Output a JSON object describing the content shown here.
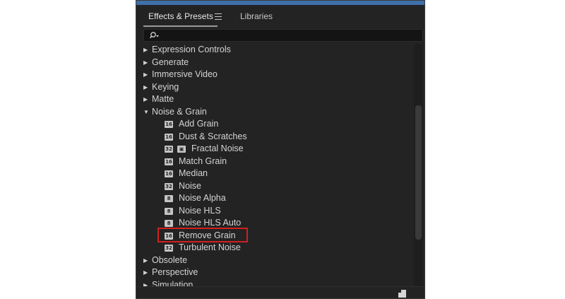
{
  "panel": {
    "tabs": [
      {
        "label": "Effects & Presets"
      },
      {
        "label": "Libraries"
      }
    ],
    "search": {
      "placeholder": ""
    },
    "items": [
      {
        "type": "group",
        "expanded": false,
        "label": "Expression Controls"
      },
      {
        "type": "group",
        "expanded": false,
        "label": "Generate"
      },
      {
        "type": "group",
        "expanded": false,
        "label": "Immersive Video"
      },
      {
        "type": "group",
        "expanded": false,
        "label": "Keying"
      },
      {
        "type": "group",
        "expanded": false,
        "label": "Matte"
      },
      {
        "type": "group",
        "expanded": true,
        "label": "Noise & Grain"
      },
      {
        "type": "effect",
        "badges": [
          "16"
        ],
        "label": "Add Grain"
      },
      {
        "type": "effect",
        "badges": [
          "16"
        ],
        "label": "Dust & Scratches"
      },
      {
        "type": "effect",
        "badges": [
          "32",
          "gpu"
        ],
        "label": "Fractal Noise"
      },
      {
        "type": "effect",
        "badges": [
          "16"
        ],
        "label": "Match Grain"
      },
      {
        "type": "effect",
        "badges": [
          "16"
        ],
        "label": "Median"
      },
      {
        "type": "effect",
        "badges": [
          "32"
        ],
        "label": "Noise"
      },
      {
        "type": "effect",
        "badges": [
          "8"
        ],
        "label": "Noise Alpha"
      },
      {
        "type": "effect",
        "badges": [
          "8"
        ],
        "label": "Noise HLS"
      },
      {
        "type": "effect",
        "badges": [
          "8"
        ],
        "label": "Noise HLS Auto"
      },
      {
        "type": "effect",
        "badges": [
          "16"
        ],
        "label": "Remove Grain",
        "highlighted": true
      },
      {
        "type": "effect",
        "badges": [
          "32"
        ],
        "label": "Turbulent Noise"
      },
      {
        "type": "group",
        "expanded": false,
        "label": "Obsolete"
      },
      {
        "type": "group",
        "expanded": false,
        "label": "Perspective"
      },
      {
        "type": "group",
        "expanded": false,
        "label": "Simulation"
      }
    ]
  },
  "colors": {
    "panel_bg": "#232323",
    "highlight_border": "#d02020",
    "accent_top": "#3f6fa8"
  }
}
